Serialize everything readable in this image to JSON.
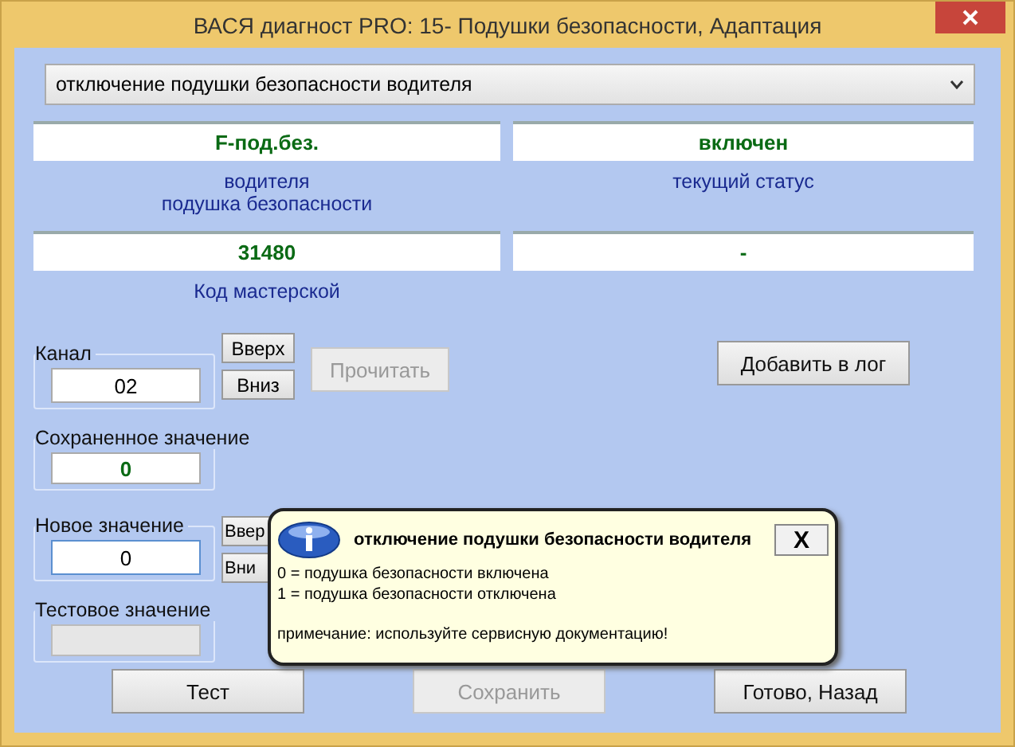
{
  "window": {
    "title": "ВАСЯ диагност PRO: 15- Подушки безопасности, Адаптация"
  },
  "dropdown": {
    "value": "отключение подушки безопасности водителя"
  },
  "info_boxes": [
    {
      "value": "F-под.без.",
      "caption": [
        "водителя",
        "подушка безопасности"
      ]
    },
    {
      "value": "включен",
      "caption": [
        "текущий статус"
      ]
    },
    {
      "value": "31480",
      "caption": [
        "Код мастерской"
      ]
    },
    {
      "value": "-"
    }
  ],
  "channel": {
    "label": "Канал",
    "value": "02",
    "up": "Вверх",
    "down": "Вниз"
  },
  "read_button": {
    "label": "Прочитать",
    "disabled": true
  },
  "log_button": {
    "label": "Добавить в лог",
    "disabled": false
  },
  "saved_value": {
    "label": "Сохраненное значение",
    "value": "0"
  },
  "new_value": {
    "label": "Новое значение",
    "value": "0",
    "up": "Ввер",
    "down": "Вни"
  },
  "test_value": {
    "label": "Тестовое значение",
    "disabled": true
  },
  "buttons": [
    {
      "label": "Тест",
      "disabled": false
    },
    {
      "label": "Сохранить",
      "disabled": true
    },
    {
      "label": "Готово, Назад",
      "disabled": false
    }
  ],
  "tooltip": {
    "title": "отключение подушки безопасности водителя",
    "close": "X",
    "lines": [
      "0 = подушка безопасности включена",
      "1 = подушка безопасности отключена"
    ],
    "note": "примечание: используйте сервисную документацию!"
  }
}
